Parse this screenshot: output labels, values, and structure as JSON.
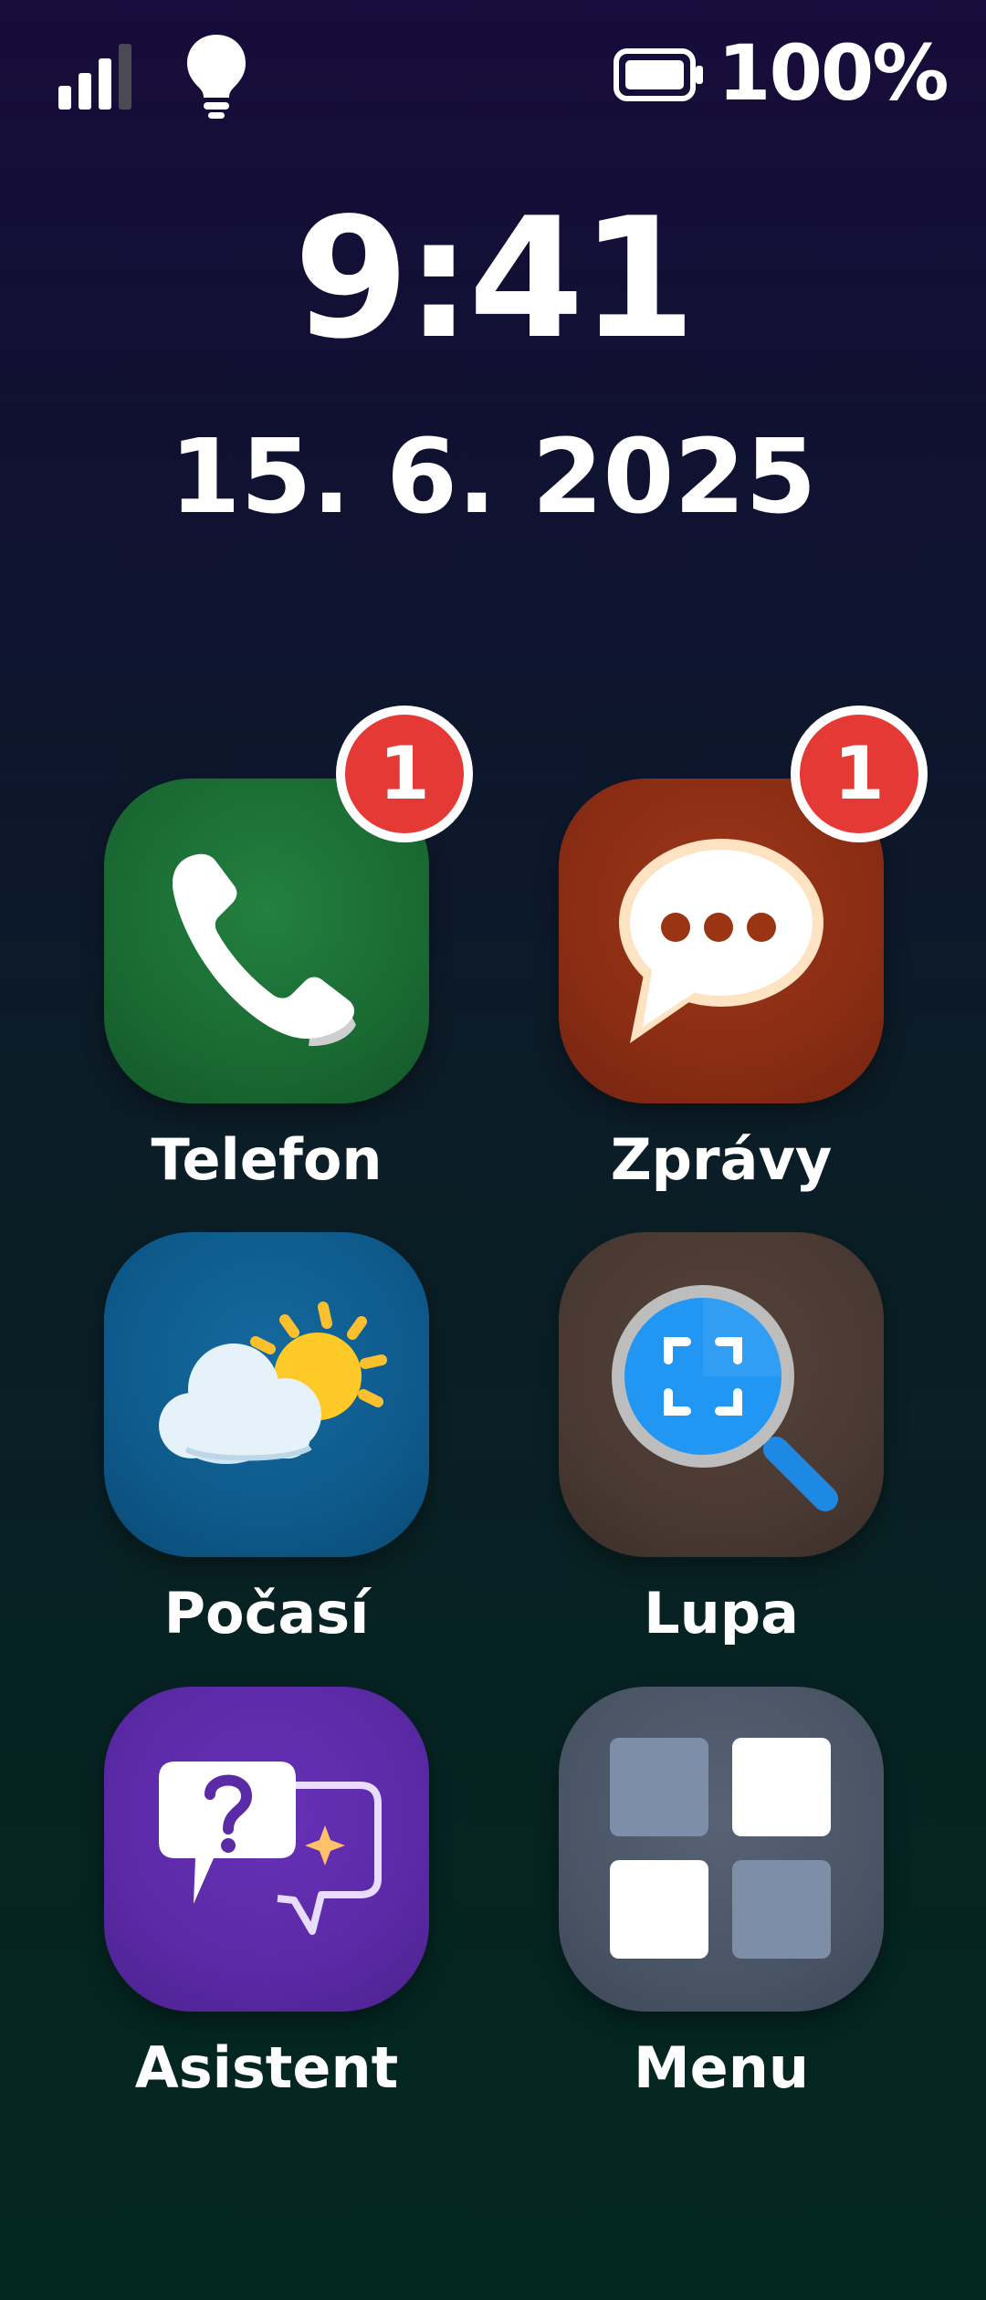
{
  "status_bar": {
    "signal_icon": "signal-bars-icon",
    "signal_bars_active": 3,
    "signal_bars_total": 4,
    "flashlight_icon": "lightbulb-icon",
    "battery_icon": "battery-icon",
    "battery_percent": "100%"
  },
  "lock": {
    "time": "9:41",
    "date": "15. 6. 2025"
  },
  "apps": {
    "phone": {
      "label": "Telefon",
      "badge": "1",
      "icon": "phone-icon",
      "color": "#1e6b35"
    },
    "messages": {
      "label": "Zprávy",
      "badge": "1",
      "icon": "chat-bubble-icon",
      "color": "#8a2d14"
    },
    "weather": {
      "label": "Počasí",
      "icon": "cloud-sun-icon",
      "color": "#0e5a8c"
    },
    "magnifier": {
      "label": "Lupa",
      "icon": "magnifier-icon",
      "color": "#4a3a33"
    },
    "assistant": {
      "label": "Asistent",
      "icon": "assistant-question-icon",
      "color": "#5b2aa6"
    },
    "menu": {
      "label": "Menu",
      "icon": "grid-menu-icon",
      "color": "#4a5566"
    }
  },
  "colors": {
    "badge": "#e53935",
    "text": "#ffffff"
  }
}
